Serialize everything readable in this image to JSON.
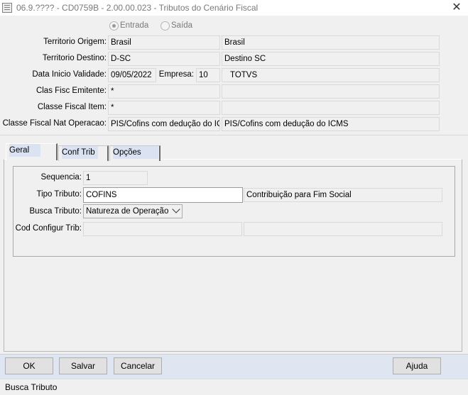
{
  "window": {
    "title": "06.9.???? - CD0759B - 2.00.00.023 - Tributos do Cenário Fiscal"
  },
  "header": {
    "radio_entrada": "Entrada",
    "radio_saida": "Saída",
    "territorio_origem": {
      "label": "Territorio Origem:",
      "code": "Brasil",
      "desc": "Brasil"
    },
    "territorio_destino": {
      "label": "Territorio Destino:",
      "code": "D-SC",
      "desc": "Destino SC"
    },
    "data_inicio": {
      "label": "Data Inicio Validade:",
      "value": "09/05/2022"
    },
    "empresa": {
      "label": "Empresa:",
      "code": "10",
      "desc": "TOTVS"
    },
    "clas_fisc_emitente": {
      "label": "Clas Fisc Emitente:",
      "code": "*",
      "desc": ""
    },
    "classe_fiscal_item": {
      "label": "Classe Fiscal Item:",
      "code": "*",
      "desc": ""
    },
    "classe_fiscal_nat": {
      "label": "Classe Fiscal Nat Operacao:",
      "code": "PIS/Cofins com dedução do ICM",
      "desc": "PIS/Cofins com dedução do ICMS"
    }
  },
  "tabs": [
    {
      "label": "Geral"
    },
    {
      "label": "Conf Trib"
    },
    {
      "label": "Opções"
    }
  ],
  "geral": {
    "sequencia": {
      "label": "Sequencia:",
      "value": "1"
    },
    "tipo_tributo": {
      "label": "Tipo Tributo:",
      "value": "COFINS",
      "desc": "Contribuição para Fim Social"
    },
    "busca_tributo": {
      "label": "Busca Tributo:",
      "value": "Natureza de Operação"
    },
    "cod_configur_trib": {
      "label": "Cod Configur Trib:",
      "code": "",
      "desc": ""
    }
  },
  "buttons": {
    "ok": "OK",
    "salvar": "Salvar",
    "cancelar": "Cancelar",
    "ajuda": "Ajuda"
  },
  "status": {
    "text": "Busca Tributo"
  }
}
